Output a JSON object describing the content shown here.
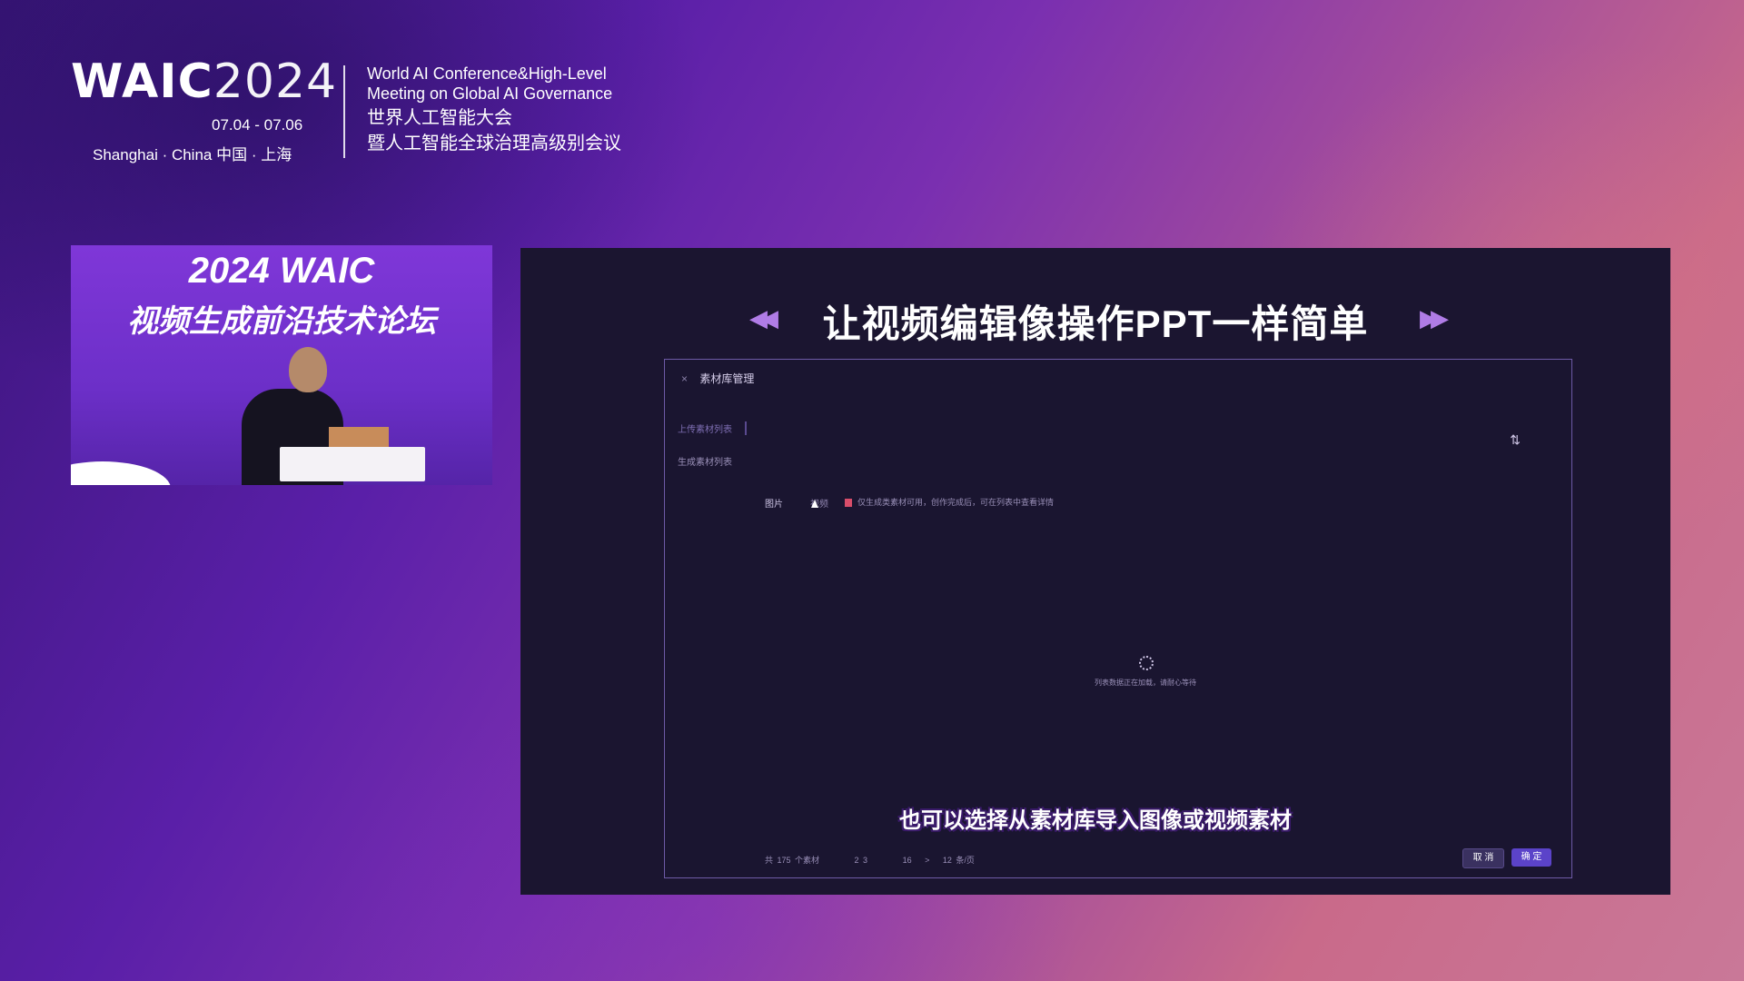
{
  "conference": {
    "logo_word": "WAIC",
    "logo_year": "2024",
    "dates": "07.04 - 07.06",
    "location": "Shanghai · China  中国 · 上海",
    "name_en_line1": "World AI Conference&High-Level",
    "name_en_line2": "Meeting on Global AI Governance",
    "name_cn_line1": "世界人工智能大会",
    "name_cn_line2": "暨人工智能全球治理高级别会议"
  },
  "camera": {
    "title_line1": "2024 WAIC",
    "title_line2": "视频生成前沿技术论坛"
  },
  "slide": {
    "title": "让视频编辑像操作PPT一样简单",
    "subtitle": "也可以选择从素材库导入图像或视频素材",
    "app": {
      "header_title": "素材库管理",
      "close_glyph": "×",
      "sidebar": [
        {
          "label": "上传素材列表",
          "active": true
        },
        {
          "label": "生成素材列表",
          "active": false
        }
      ],
      "sort_glyph": "⇅",
      "tabs": [
        {
          "label": "图片"
        },
        {
          "label": "视频"
        }
      ],
      "notice": "仅生成类素材可用，创作完成后，可在列表中查看详情",
      "loading_text": "列表数据正在加载，请耐心等待",
      "pagination": {
        "total": "共 175 个素材",
        "pages": "2  3",
        "last_page": "16",
        "next": ">",
        "per_page": "12 条/页"
      },
      "cancel_label": "取 消",
      "ok_label": "确 定"
    }
  },
  "colors": {
    "slide_bg": "#1b1530",
    "accent": "#5b43c9",
    "arrow": "#b07ce6"
  }
}
